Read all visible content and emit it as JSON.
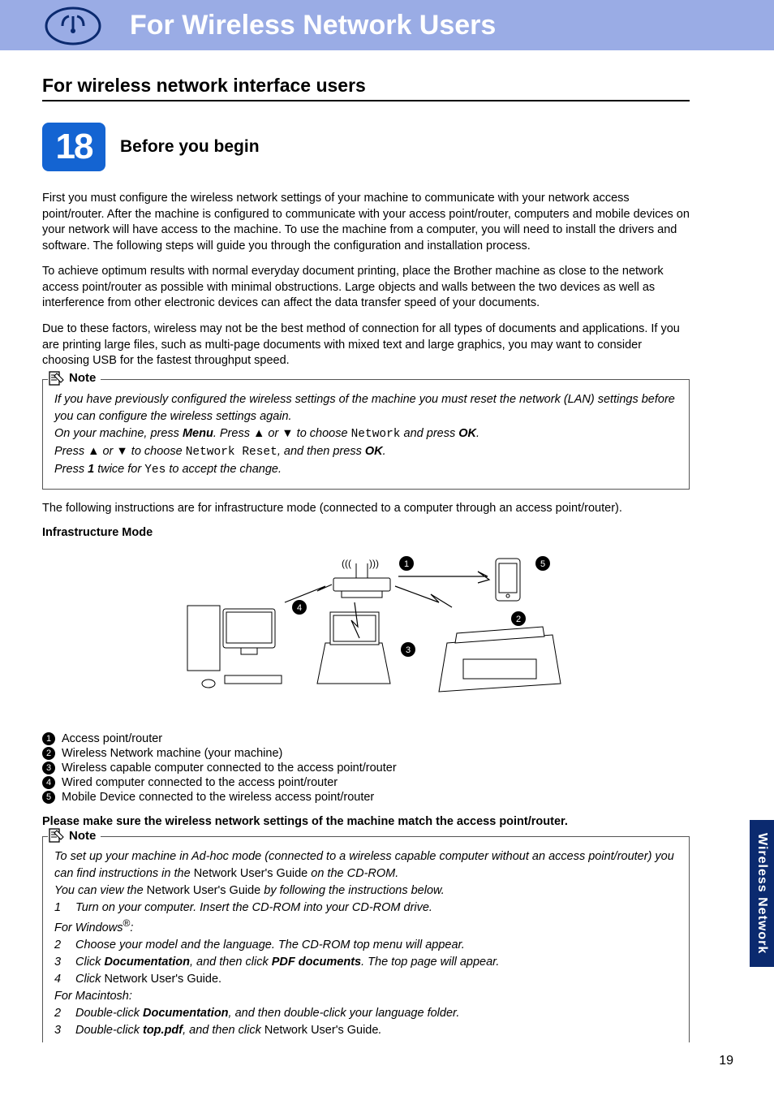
{
  "header": {
    "title": "For Wireless Network Users"
  },
  "section_title": "For wireless network interface users",
  "step": {
    "number": "18",
    "heading": "Before you begin"
  },
  "para1": "First you must configure the wireless network settings of your machine to communicate with your network access point/router. After the machine is configured to communicate with your access point/router, computers and mobile devices on your network will have access to the machine. To use the machine from a computer, you will need to install the drivers and software. The following steps will guide you through the configuration and installation process.",
  "para2": "To achieve optimum results with normal everyday document printing, place the Brother machine as close to the network access point/router as possible with minimal obstructions. Large objects and walls between the two devices as well as interference from other electronic devices can affect the data transfer speed of your documents.",
  "para3": "Due to these factors, wireless may not be the best method of connection for all types of documents and applications. If you are printing large files, such as multi-page documents with mixed text and large graphics, you may want to consider choosing USB for the fastest throughput speed.",
  "note1": {
    "label": "Note",
    "l1a": "If you have previously configured the wireless settings of the machine you must reset the network (LAN) settings before you can configure the wireless settings again.",
    "l2_pre": "On your machine, press ",
    "menu": "Menu",
    "l2_mid": ". Press ",
    "up": "a",
    "or": " or ",
    "dn": "b",
    "l2_choose": " to choose ",
    "network": "Network",
    "l2_press": " and press ",
    "ok": "OK",
    "period": ".",
    "l3_pre": "Press ",
    "l3_choose": " to choose ",
    "nr": "Network Reset",
    "l3_then": ", and then press ",
    "l4_pre": "Press ",
    "one": "1",
    "l4_mid": " twice for ",
    "yes": "Yes",
    "l4_end": " to accept the change."
  },
  "para4": "The following instructions are for infrastructure mode (connected to a computer through an access point/router).",
  "infra_title": "Infrastructure Mode",
  "legend": [
    "Access point/router",
    "Wireless Network machine (your machine)",
    "Wireless capable computer connected to the access point/router",
    "Wired computer connected to the access point/router",
    "Mobile Device connected to the wireless access point/router"
  ],
  "ensure": "Please make sure the wireless network settings of the machine match the access point/router.",
  "note2": {
    "label": "Note",
    "l1a": "To set up your machine in Ad-hoc mode (connected to a wireless capable computer without an access point/router) you can find instructions in the ",
    "nug": "Network User's Guide",
    "l1b": " on the CD-ROM.",
    "l2a": "You can view the ",
    "l2b": " by following the instructions below.",
    "s1": "Turn on your computer. Insert the CD-ROM into your CD-ROM drive.",
    "win_pre": "For Windows",
    "win_sup": "®",
    "win_post": ":",
    "s2": "Choose your model and the language. The CD-ROM top menu will appear.",
    "s3a": "Click ",
    "doc": "Documentation",
    "s3b": ", and then click ",
    "pdf": "PDF documents",
    "s3c": ". The top page will appear.",
    "s4a": "Click ",
    "s4b": "Network User's Guide.",
    "mac": "For Macintosh:",
    "m2a": "Double-click ",
    "m2b": ", and then double-click your language folder.",
    "m3a": "Double-click ",
    "top": "top.pdf",
    "m3b": ", and then click ",
    "m3c": "Network User's Guide",
    "m3d": "."
  },
  "side_tab": "Wireless Network",
  "page_number": "19"
}
